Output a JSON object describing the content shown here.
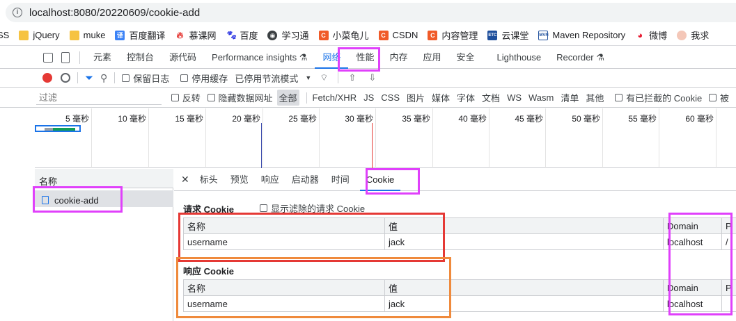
{
  "browser": {
    "url": "localhost:8080/20220609/cookie-add"
  },
  "bookmarks": [
    {
      "label": "SS",
      "icon": "text-icon"
    },
    {
      "label": "jQuery",
      "icon": "folder-icon"
    },
    {
      "label": "muke",
      "icon": "folder-icon"
    },
    {
      "label": "百度翻译",
      "icon": "baidu-translate-icon"
    },
    {
      "label": "慕课网",
      "icon": "flame-icon"
    },
    {
      "label": "百度",
      "icon": "baidu-paw-icon"
    },
    {
      "label": "学习通",
      "icon": "globe-icon"
    },
    {
      "label": "小菜龟儿",
      "icon": "csdn-c-icon"
    },
    {
      "label": "CSDN",
      "icon": "csdn-c-icon"
    },
    {
      "label": "内容管理",
      "icon": "csdn-c-icon"
    },
    {
      "label": "云课堂",
      "icon": "etc-icon"
    },
    {
      "label": "Maven Repository",
      "icon": "mvn-icon"
    },
    {
      "label": "微博",
      "icon": "weibo-icon"
    },
    {
      "label": "我求",
      "icon": "avatar-icon"
    }
  ],
  "devtools": {
    "tabs": [
      "元素",
      "控制台",
      "源代码",
      "Performance insights",
      "网络",
      "性能",
      "内存",
      "应用",
      "安全",
      "Lighthouse",
      "Recorder"
    ],
    "selected_tab": "网络",
    "toolbar": {
      "preserve_log": "保留日志",
      "disable_cache": "停用缓存",
      "throttling": "已停用节流模式"
    },
    "filter": {
      "placeholder": "过滤",
      "invert": "反转",
      "hide_data_urls": "隐藏数据网址",
      "types": [
        "全部",
        "Fetch/XHR",
        "JS",
        "CSS",
        "图片",
        "媒体",
        "字体",
        "文档",
        "WS",
        "Wasm",
        "清单",
        "其他"
      ],
      "selected_type": "全部",
      "blocked_cookies": "有已拦截的 Cookie",
      "trailing": "被"
    },
    "timeline_ticks": [
      "5 毫秒",
      "10 毫秒",
      "15 毫秒",
      "20 毫秒",
      "25 毫秒",
      "30 毫秒",
      "35 毫秒",
      "40 毫秒",
      "45 毫秒",
      "50 毫秒",
      "55 毫秒",
      "60 毫秒"
    ],
    "requests_header": "名称",
    "request_name": "cookie-add",
    "detail_tabs": [
      "标头",
      "预览",
      "响应",
      "启动器",
      "时间",
      "Cookie"
    ],
    "selected_detail_tab": "Cookie",
    "request_cookies": {
      "title": "请求 Cookie",
      "show_filtered": "显示滤除的请求 Cookie",
      "columns": [
        "名称",
        "值",
        "Domain",
        "P"
      ],
      "rows": [
        [
          "username",
          "jack",
          "localhost",
          "/"
        ]
      ]
    },
    "response_cookies": {
      "title": "响应 Cookie",
      "columns": [
        "名称",
        "值",
        "Domain",
        "P"
      ],
      "rows": [
        [
          "username",
          "jack",
          "localhost",
          ""
        ]
      ]
    }
  },
  "colors": {
    "magenta_box": "#e040fb",
    "red_box": "#e53935",
    "orange_box": "#ef8a3c",
    "accent": "#1a73e8"
  }
}
